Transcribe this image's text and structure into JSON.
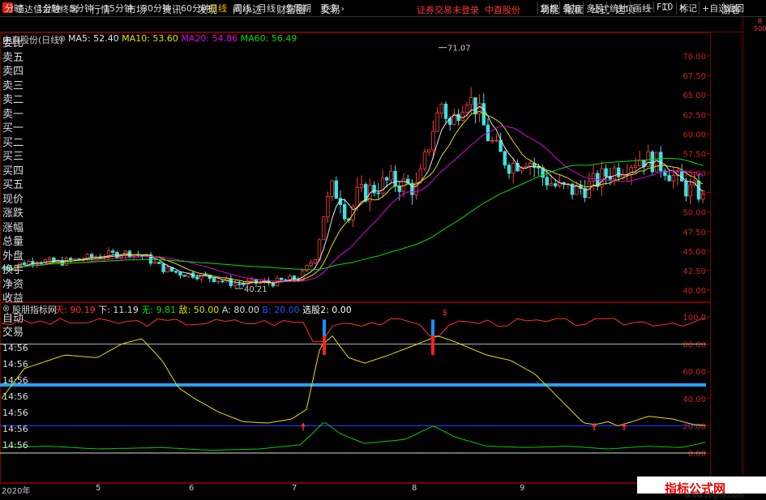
{
  "menu": {
    "app_title": "通达信金融终端",
    "items": [
      "行情",
      "市场",
      "资讯",
      "发现",
      "问小达",
      "财富圈",
      "交易"
    ],
    "notice": "证券交易未登录",
    "stock_tag": "中直股份",
    "right_items": [
      "功能",
      "版面",
      "公式",
      "选项"
    ],
    "guest": "游客"
  },
  "toolbar": {
    "periods": [
      "分时",
      "1分钟",
      "5分钟",
      "15分钟",
      "30分钟",
      "60分钟",
      "日线",
      "周线",
      "月线",
      "多周期",
      "更多"
    ],
    "active": "日线",
    "right": [
      "复权",
      "叠加",
      "多股",
      "统计",
      "画线",
      "F10",
      "标记",
      "+自选",
      "返回"
    ]
  },
  "main_chart": {
    "stock_label": "中直股份(日线)",
    "ma": [
      {
        "label": "MA5: 52.40",
        "color": "#e6e6e6"
      },
      {
        "label": "MA10: 53.60",
        "color": "#e8e000"
      },
      {
        "label": "MA20: 54.86",
        "color": "#e000e0"
      },
      {
        "label": "MA60: 56.49",
        "color": "#00e000"
      }
    ],
    "price_ticks": [
      "70.00",
      "67.50",
      "65.00",
      "62.50",
      "60.00",
      "57.50",
      "55.00",
      "52.50",
      "50.00",
      "47.50",
      "45.00",
      "42.50",
      "40.00"
    ],
    "high_label": "71.07",
    "low_label": "40.21"
  },
  "indicator": {
    "name": "股朋指标网",
    "fields": [
      {
        "label": "天: 90.19",
        "color": "#ff3030"
      },
      {
        "label": "下: 11.19",
        "color": "#dddddd"
      },
      {
        "label": "无: 9.81",
        "color": "#00e000"
      },
      {
        "label": "敌: 50.00",
        "color": "#e8e000"
      },
      {
        "label": "A: 80.00",
        "color": "#dddddd"
      },
      {
        "label": "B: 20.00",
        "color": "#2050ff"
      },
      {
        "label": "选股2: 0.00",
        "color": "#ffffff"
      }
    ],
    "ticks": [
      "100.0",
      "80.00",
      "60.00",
      "40.00",
      "20.00",
      "0.00"
    ]
  },
  "side_panel": {
    "badge_top": "R",
    "badge_bottom": "500",
    "items": [
      "委比",
      "卖五",
      "卖四",
      "卖三",
      "卖二",
      "卖一",
      "买一",
      "买二",
      "买三",
      "买四",
      "买五",
      "现价",
      "涨跌",
      "涨幅",
      "总量",
      "外盘",
      "换手",
      "净资",
      "收益"
    ],
    "lower_items": [
      "自动",
      "交易"
    ],
    "times": [
      "14:56",
      "14:56",
      "14:56",
      "14:56",
      "14:56",
      "14:56",
      "14:56"
    ]
  },
  "xaxis": [
    "2020年",
    "5",
    "6",
    "7",
    "8",
    "9"
  ],
  "watermark": {
    "main": "指标公式网",
    "sub": "www.zbgs3.com"
  }
}
